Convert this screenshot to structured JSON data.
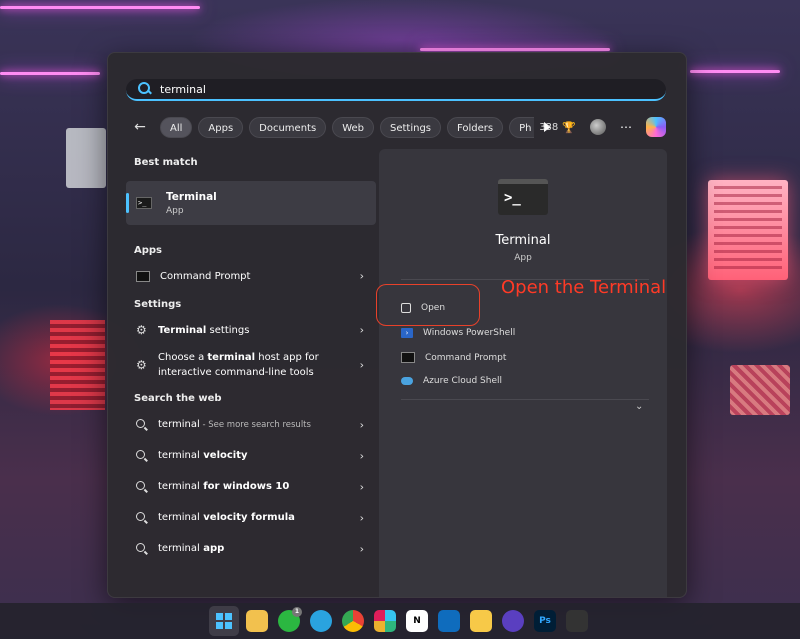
{
  "search": {
    "query": "terminal"
  },
  "filters": {
    "chips": [
      "All",
      "Apps",
      "Documents",
      "Web",
      "Settings",
      "Folders",
      "Ph"
    ],
    "active": "All",
    "points": "338"
  },
  "left": {
    "best_match_heading": "Best match",
    "best_match": {
      "title": "Terminal",
      "subtitle": "App"
    },
    "apps_heading": "Apps",
    "apps": [
      {
        "label": "Command Prompt"
      }
    ],
    "settings_heading": "Settings",
    "settings": [
      {
        "bold": "Terminal",
        "rest": " settings"
      },
      {
        "line1_pre": "Choose a ",
        "line1_bold": "terminal",
        "line1_post": " host app for",
        "line2": "interactive command-line tools"
      }
    ],
    "web_heading": "Search the web",
    "web": [
      {
        "pre": "terminal",
        "bold": "",
        "suffix": " - See more search results"
      },
      {
        "pre": "terminal",
        "bold": " velocity",
        "suffix": ""
      },
      {
        "pre": "terminal",
        "bold": " for windows 10",
        "suffix": ""
      },
      {
        "pre": "terminal",
        "bold": " velocity formula",
        "suffix": ""
      },
      {
        "pre": "terminal",
        "bold": " app",
        "suffix": ""
      }
    ]
  },
  "detail": {
    "title": "Terminal",
    "type": "App",
    "actions": [
      "Open",
      "Windows PowerShell",
      "Command Prompt",
      "Azure Cloud Shell"
    ]
  },
  "annotation": {
    "text": "Open the Terminal",
    "color": "#ff3a26"
  },
  "taskbar": {
    "icons": [
      "windows-start-icon",
      "file-explorer-icon",
      "whatsapp-icon",
      "telegram-icon",
      "chrome-icon",
      "slack-icon",
      "notion-icon",
      "outlook-icon",
      "notes-icon",
      "browser-icon",
      "photoshop-icon",
      "davinci-icon"
    ],
    "whatsapp_badge": "1",
    "photoshop_label": "Ps"
  }
}
